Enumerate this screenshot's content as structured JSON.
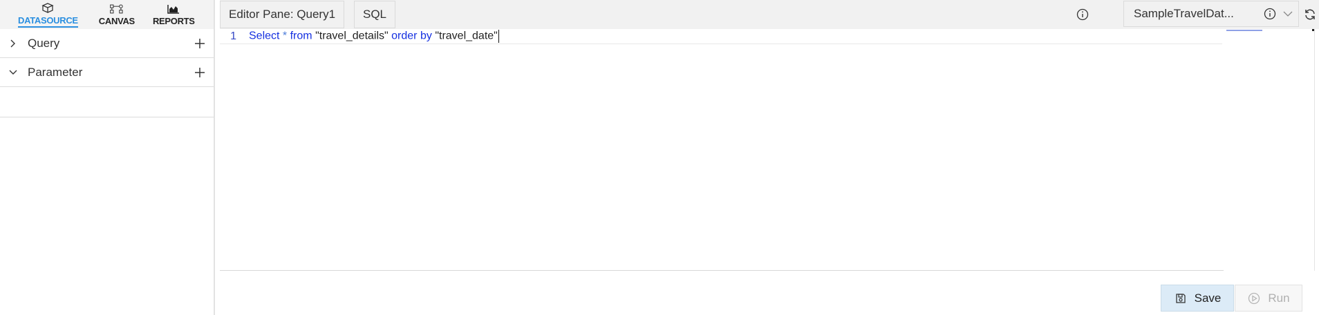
{
  "sidebar": {
    "nav_tabs": [
      {
        "label": "DATASOURCE",
        "icon": "datasource-icon",
        "active": true
      },
      {
        "label": "CANVAS",
        "icon": "canvas-icon",
        "active": false
      },
      {
        "label": "REPORTS",
        "icon": "reports-icon",
        "active": false
      }
    ],
    "tree": [
      {
        "label": "Query",
        "expanded": false,
        "icon": "chevron-right-icon"
      },
      {
        "label": "Parameter",
        "expanded": true,
        "icon": "chevron-down-icon"
      }
    ]
  },
  "header": {
    "editor_tab_label": "Editor Pane: Query1",
    "sql_tab_label": "SQL",
    "datasource_value": "SampleTravelDat..."
  },
  "editor": {
    "line_number": "1",
    "tokens": {
      "select": "Select",
      "star": "*",
      "from": "from",
      "table": "\"travel_details\"",
      "order_by": "order by",
      "column": "\"travel_date\""
    }
  },
  "footer": {
    "save_label": "Save",
    "run_label": "Run"
  },
  "colors": {
    "accent": "#2b8fe0",
    "keyword": "#1530e0",
    "save_bg": "#dcebf7",
    "header_bg": "#f1f1f1"
  }
}
